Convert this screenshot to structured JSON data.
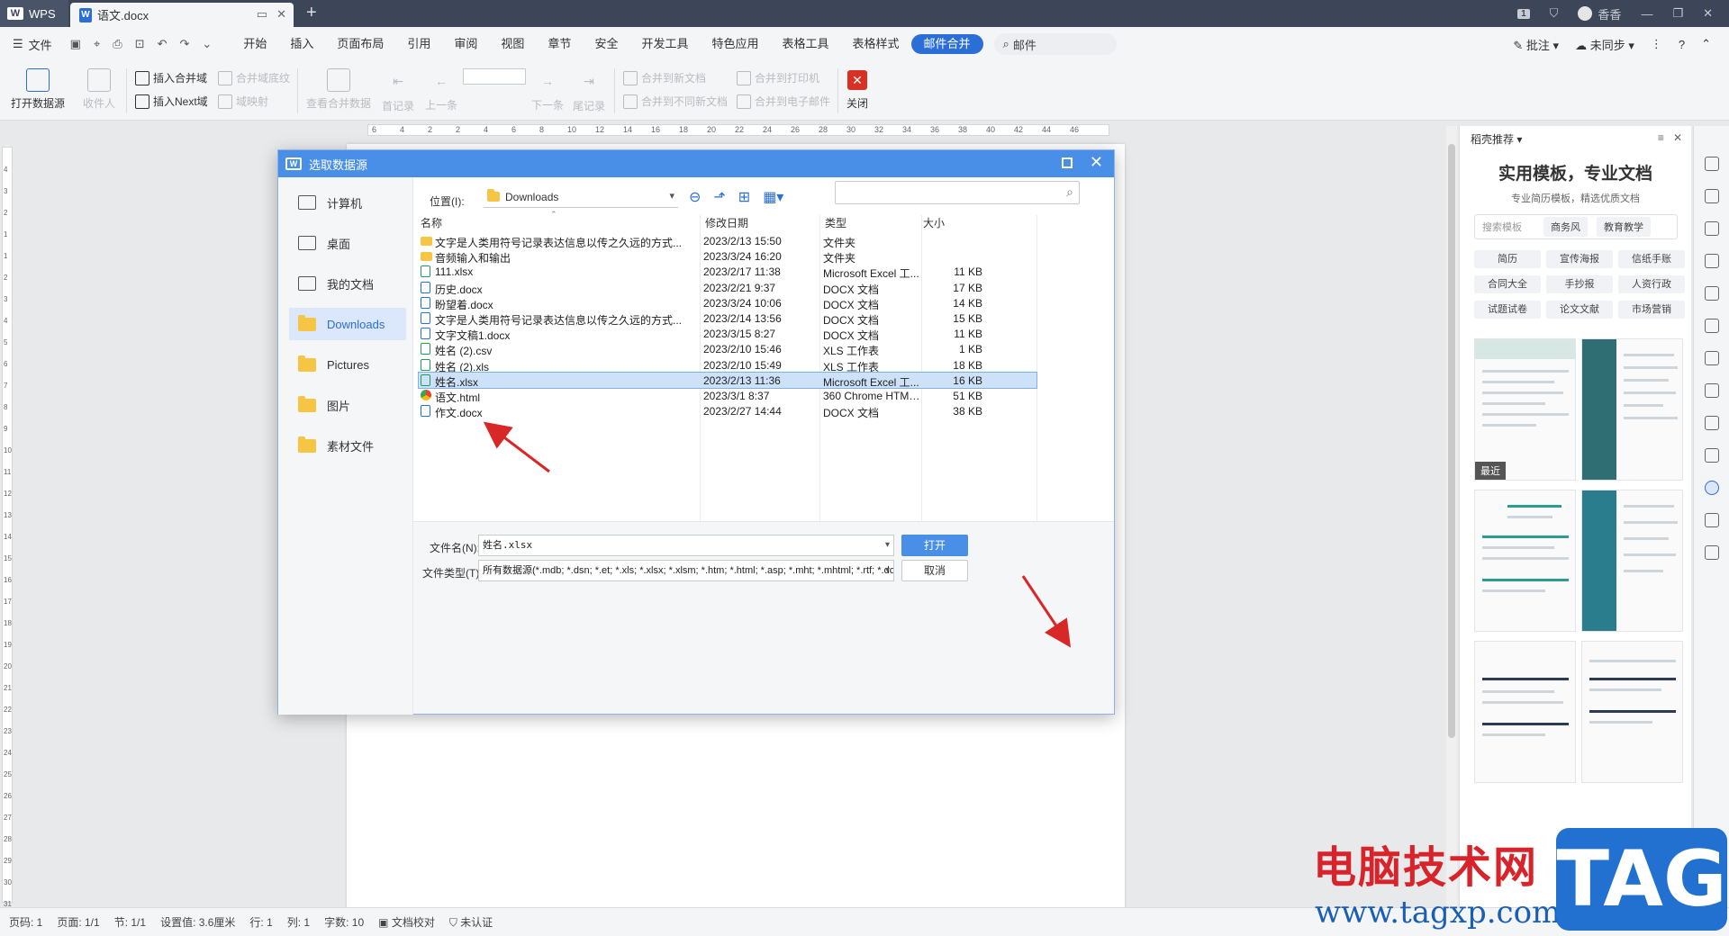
{
  "titlebar": {
    "app": "WPS",
    "tab": "语文.docx",
    "right_user": "香香",
    "badge": "1"
  },
  "menubar": {
    "file": "文件",
    "items": [
      "开始",
      "插入",
      "页面布局",
      "引用",
      "审阅",
      "视图",
      "章节",
      "安全",
      "开发工具",
      "特色应用",
      "表格工具",
      "表格样式",
      "邮件合并"
    ],
    "active": "邮件合并",
    "search": "邮件",
    "right": [
      "批注",
      "未同步"
    ]
  },
  "ribbon": {
    "open_source": "打开数据源",
    "recipients": "收件人",
    "insert_merge_field": "插入合并域",
    "merge_field_shading": "合并域底纹",
    "insert_next": "插入Next域",
    "field_mapping": "域映射",
    "view_merged": "查看合并数据",
    "first": "首记录",
    "prev": "上一条",
    "next": "下一条",
    "last": "尾记录",
    "merge_new_doc": "合并到新文档",
    "merge_printer": "合并到打印机",
    "merge_diff_doc": "合并到不同新文档",
    "merge_email": "合并到电子邮件",
    "close": "关闭"
  },
  "ruler": {
    "h_ticks": [
      "6",
      "4",
      "2",
      "2",
      "4",
      "6",
      "8",
      "10",
      "12",
      "14",
      "16",
      "18",
      "20",
      "22",
      "24",
      "26",
      "28",
      "30",
      "32",
      "34",
      "36",
      "38",
      "40",
      "42",
      "44",
      "46"
    ],
    "v_ticks": [
      "4",
      "3",
      "2",
      "1",
      "1",
      "2",
      "3",
      "4",
      "5",
      "6",
      "7",
      "8",
      "9",
      "10",
      "11",
      "12",
      "13",
      "14",
      "15",
      "16",
      "17",
      "18",
      "19",
      "20",
      "21",
      "22",
      "23",
      "24",
      "25",
      "26",
      "27",
      "28",
      "29",
      "30",
      "31"
    ]
  },
  "dialog": {
    "title": "选取数据源",
    "sidebar": [
      "计算机",
      "桌面",
      "我的文档",
      "Downloads",
      "Pictures",
      "图片",
      "素材文件"
    ],
    "sidebar_active": "Downloads",
    "location_label": "位置(I):",
    "location_value": "Downloads",
    "columns": {
      "name": "名称",
      "date": "修改日期",
      "type": "类型",
      "size": "大小"
    },
    "files": [
      {
        "icon": "folder",
        "name": "文字是人类用符号记录表达信息以传之久远的方式...",
        "date": "2023/2/13 15:50",
        "type": "文件夹",
        "size": ""
      },
      {
        "icon": "folder",
        "name": "音频输入和输出",
        "date": "2023/3/24 16:20",
        "type": "文件夹",
        "size": ""
      },
      {
        "icon": "xlsx",
        "name": "111.xlsx",
        "date": "2023/2/17 11:38",
        "type": "Microsoft Excel 工...",
        "size": "11 KB"
      },
      {
        "icon": "docx",
        "name": "历史.docx",
        "date": "2023/2/21 9:37",
        "type": "DOCX 文档",
        "size": "17 KB"
      },
      {
        "icon": "docx",
        "name": "盼望着.docx",
        "date": "2023/3/24 10:06",
        "type": "DOCX 文档",
        "size": "14 KB"
      },
      {
        "icon": "docx",
        "name": "文字是人类用符号记录表达信息以传之久远的方式...",
        "date": "2023/2/14 13:56",
        "type": "DOCX 文档",
        "size": "15 KB"
      },
      {
        "icon": "docx",
        "name": "文字文稿1.docx",
        "date": "2023/3/15 8:27",
        "type": "DOCX 文档",
        "size": "11 KB"
      },
      {
        "icon": "xlsx",
        "name": "姓名 (2).csv",
        "date": "2023/2/10 15:46",
        "type": "XLS 工作表",
        "size": "1 KB"
      },
      {
        "icon": "xlsx",
        "name": "姓名 (2).xls",
        "date": "2023/2/10 15:49",
        "type": "XLS 工作表",
        "size": "18 KB"
      },
      {
        "icon": "xlsx",
        "name": "姓名.xlsx",
        "date": "2023/2/13 11:36",
        "type": "Microsoft Excel 工...",
        "size": "16 KB",
        "selected": true
      },
      {
        "icon": "html",
        "name": "语文.html",
        "date": "2023/3/1 8:37",
        "type": "360 Chrome HTML...",
        "size": "51 KB"
      },
      {
        "icon": "docx",
        "name": "作文.docx",
        "date": "2023/2/27 14:44",
        "type": "DOCX 文档",
        "size": "38 KB"
      }
    ],
    "filename_label": "文件名(N):",
    "filename_value": "姓名.xlsx",
    "filetype_label": "文件类型(T):",
    "filetype_value": "所有数据源(*.mdb; *.dsn; *.et; *.xls; *.xlsx; *.xlsm; *.htm; *.html; *.asp; *.mht; *.mhtml; *.rtf; *.docx; *.doc",
    "open": "打开",
    "cancel": "取消"
  },
  "right_panel": {
    "header": "稻壳推荐",
    "title": "实用模板，专业文档",
    "subtitle": "专业简历模板，精选优质文档",
    "search_placeholder": "搜索模板",
    "search_chips": [
      "商务风",
      "教育教学"
    ],
    "categories": [
      "简历",
      "宣传海报",
      "信纸手账",
      "合同大全",
      "手抄报",
      "人资行政",
      "试题试卷",
      "论文文献",
      "市场营销"
    ],
    "recent_tag": "最近"
  },
  "statusbar": [
    "页码: 1",
    "页面: 1/1",
    "节: 1/1",
    "设置值: 3.6厘米",
    "行: 1",
    "列: 1",
    "字数: 10",
    "文档校对",
    "未认证"
  ],
  "watermark": {
    "text": "电脑技术网",
    "url": "www.tagxp.com",
    "logo": "TAG"
  }
}
